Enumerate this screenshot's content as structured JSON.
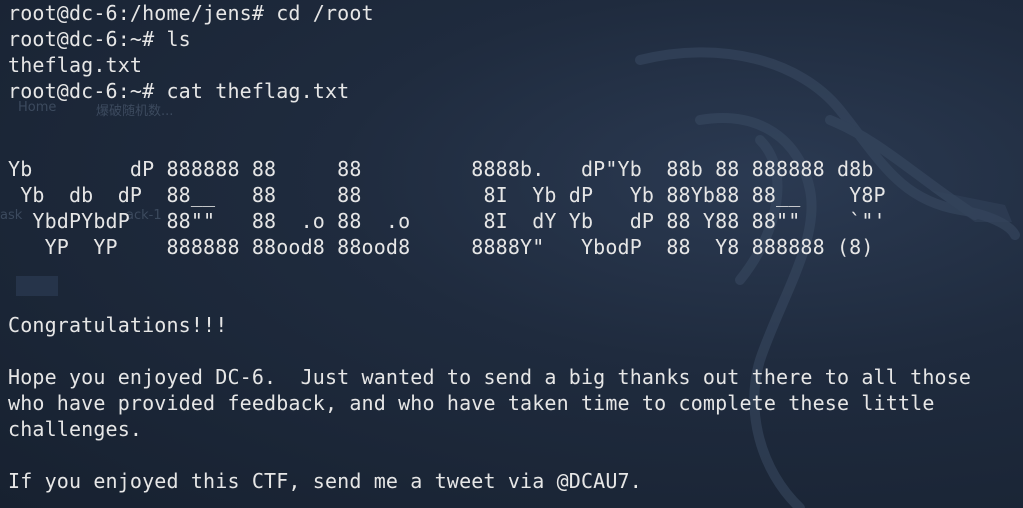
{
  "terminal": {
    "lines": [
      "root@dc-6:/home/jens# cd /root",
      "root@dc-6:~# ls",
      "theflag.txt",
      "root@dc-6:~# cat theflag.txt",
      "",
      "",
      "Yb        dP 888888 88     88         8888b.   dP\"Yb  88b 88 888888 d8b",
      " Yb  db  dP  88__   88     88          8I  Yb dP   Yb 88Yb88 88__    Y8P",
      "  YbdPYbdP   88\"\"   88  .o 88  .o      8I  dY Yb   dP 88 Y88 88\"\"    `\"'",
      "   YP  YP    888888 88ood8 88ood8     8888Y\"   YbodP  88  Y8 888888 (8)",
      "",
      "",
      "Congratulations!!!",
      "",
      "Hope you enjoyed DC-6.  Just wanted to send a big thanks out there to all those",
      "who have provided feedback, and who have taken time to complete these little",
      "challenges.",
      "",
      "If you enjoyed this CTF, send me a tweet via @DCAU7."
    ]
  },
  "background": {
    "ghost_texts": [
      "Home",
      "爆破随机数...",
      "ask",
      "ack-1"
    ],
    "colors": {
      "bg": "#1b2535",
      "text": "#e6e6e6"
    }
  }
}
